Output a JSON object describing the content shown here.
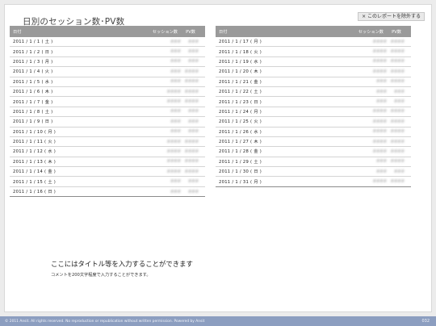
{
  "header": {
    "title": "日別のセッション数･PV数",
    "exclude_label": "× このレポートを除外する"
  },
  "table_columns": {
    "date": "日付",
    "sessions": "セッション数",
    "pv": "PV数"
  },
  "left_rows": [
    {
      "date": "2011 / 1 / 1 ( 土 )",
      "sessions": "###",
      "pv": "###"
    },
    {
      "date": "2011 / 1 / 2 ( 日 )",
      "sessions": "###",
      "pv": "###"
    },
    {
      "date": "2011 / 1 / 3 ( 月 )",
      "sessions": "###",
      "pv": "###"
    },
    {
      "date": "2011 / 1 / 4 ( 火 )",
      "sessions": "###",
      "pv": "####"
    },
    {
      "date": "2011 / 1 / 5 ( 水 )",
      "sessions": "###",
      "pv": "####"
    },
    {
      "date": "2011 / 1 / 6 ( 木 )",
      "sessions": "####",
      "pv": "####"
    },
    {
      "date": "2011 / 1 / 7 ( 金 )",
      "sessions": "####",
      "pv": "####"
    },
    {
      "date": "2011 / 1 / 8 ( 土 )",
      "sessions": "###",
      "pv": "###"
    },
    {
      "date": "2011 / 1 / 9 ( 日 )",
      "sessions": "###",
      "pv": "###"
    },
    {
      "date": "2011 / 1 / 10 ( 月 )",
      "sessions": "###",
      "pv": "###"
    },
    {
      "date": "2011 / 1 / 11 ( 火 )",
      "sessions": "####",
      "pv": "####"
    },
    {
      "date": "2011 / 1 / 12 ( 水 )",
      "sessions": "####",
      "pv": "####"
    },
    {
      "date": "2011 / 1 / 13 ( 木 )",
      "sessions": "####",
      "pv": "####"
    },
    {
      "date": "2011 / 1 / 14 ( 金 )",
      "sessions": "####",
      "pv": "####"
    },
    {
      "date": "2011 / 1 / 15 ( 土 )",
      "sessions": "###",
      "pv": "###"
    },
    {
      "date": "2011 / 1 / 16 ( 日 )",
      "sessions": "###",
      "pv": "###"
    }
  ],
  "right_rows": [
    {
      "date": "2011 / 1 / 17 ( 月 )",
      "sessions": "####",
      "pv": "####"
    },
    {
      "date": "2011 / 1 / 18 ( 火 )",
      "sessions": "####",
      "pv": "####"
    },
    {
      "date": "2011 / 1 / 19 ( 水 )",
      "sessions": "####",
      "pv": "####"
    },
    {
      "date": "2011 / 1 / 20 ( 木 )",
      "sessions": "####",
      "pv": "####"
    },
    {
      "date": "2011 / 1 / 21 ( 金 )",
      "sessions": "###",
      "pv": "####"
    },
    {
      "date": "2011 / 1 / 22 ( 土 )",
      "sessions": "###",
      "pv": "###"
    },
    {
      "date": "2011 / 1 / 23 ( 日 )",
      "sessions": "###",
      "pv": "###"
    },
    {
      "date": "2011 / 1 / 24 ( 月 )",
      "sessions": "####",
      "pv": "####"
    },
    {
      "date": "2011 / 1 / 25 ( 火 )",
      "sessions": "####",
      "pv": "####"
    },
    {
      "date": "2011 / 1 / 26 ( 水 )",
      "sessions": "####",
      "pv": "####"
    },
    {
      "date": "2011 / 1 / 27 ( 木 )",
      "sessions": "####",
      "pv": "####"
    },
    {
      "date": "2011 / 1 / 28 ( 金 )",
      "sessions": "####",
      "pv": "####"
    },
    {
      "date": "2011 / 1 / 29 ( 土 )",
      "sessions": "###",
      "pv": "####"
    },
    {
      "date": "2011 / 1 / 30 ( 日 )",
      "sessions": "###",
      "pv": "###"
    },
    {
      "date": "2011 / 1 / 31 ( 月 )",
      "sessions": "####",
      "pv": "####"
    }
  ],
  "section": {
    "title": "ここにはタイトル等を入力することができます",
    "comment": "コメントを200文字程度で入力することができます。"
  },
  "footer": {
    "copyright": "© 2011 Ansit. All rights reserved. No reproduction or republication without written permission. Powered by Ansit",
    "page_number": "032"
  }
}
